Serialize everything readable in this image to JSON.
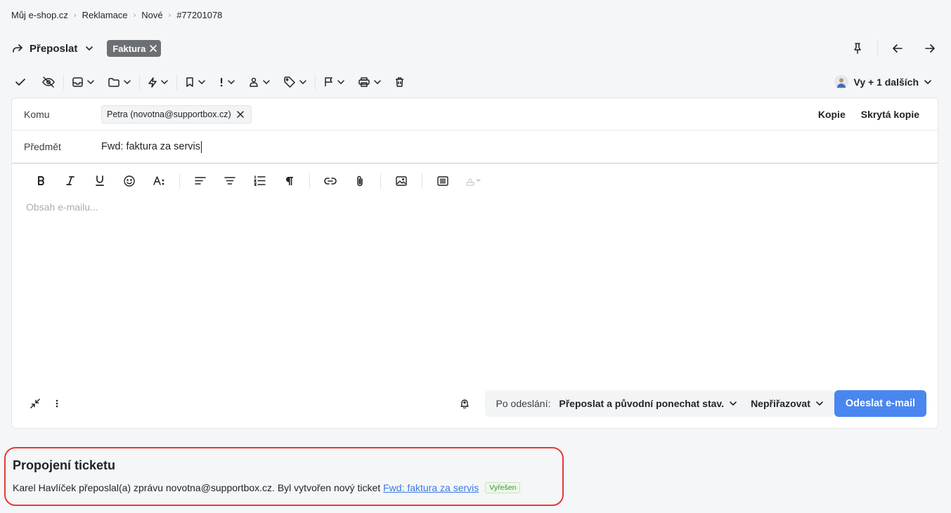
{
  "breadcrumb": {
    "items": [
      "Můj e-shop.cz",
      "Reklamace",
      "Nové"
    ],
    "current": "#77201078"
  },
  "action": {
    "forward_label": "Přeposlat",
    "tag_label": "Faktura"
  },
  "toolbar": {
    "users_label": "Vy + 1 dalších"
  },
  "composer": {
    "to_label": "Komu",
    "recipient": "Petra (novotna@supportbox.cz)",
    "cc_label": "Kopie",
    "bcc_label": "Skrytá kopie",
    "subject_label": "Předmět",
    "subject_value": "Fwd: faktura za servis",
    "body_placeholder": "Obsah e-mailu..."
  },
  "footer": {
    "after_send_label": "Po odeslání:",
    "after_send_value": "Přeposlat a původní ponechat stav.",
    "assign_value": "Nepřiřazovat",
    "send_label": "Odeslat e-mail"
  },
  "link_section": {
    "title": "Propojení ticketu",
    "text": "Karel Havlíček přeposlal(a) zprávu novotna@supportbox.cz. Byl vytvořen nový ticket",
    "link_text": "Fwd: faktura za servis",
    "status_badge": "Vyřešen"
  },
  "colors": {
    "primary": "#4a86f0",
    "tag_bg": "#6b7075",
    "highlight_border": "#e53935",
    "success": "#3c8a3e"
  }
}
